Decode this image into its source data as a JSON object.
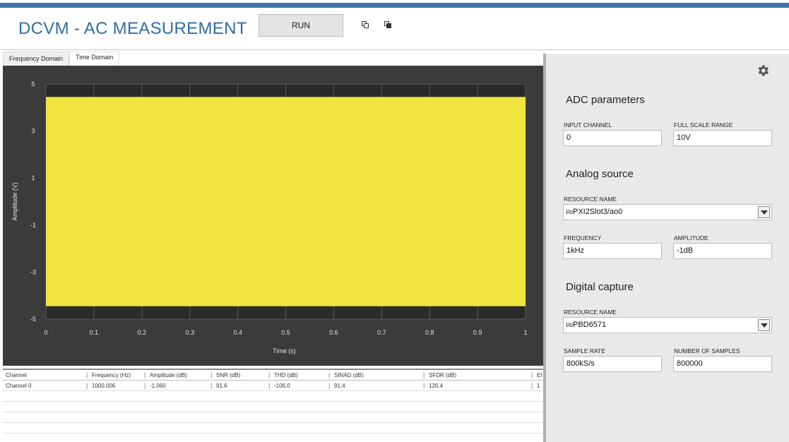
{
  "app": {
    "title": "DCVM  -  AC MEASUREMENT",
    "run_label": "RUN",
    "accent_color": "#3c74a8"
  },
  "icons": [
    "restore-window-icon",
    "restore-window-filled-icon",
    "gear-icon",
    "io-channel-icon",
    "dropdown-arrow-icon"
  ],
  "tabs": [
    {
      "label": "Frequency Domain",
      "active": false
    },
    {
      "label": "Time Domain",
      "active": true
    }
  ],
  "chart_data": {
    "type": "area",
    "title": "",
    "xlabel": "Time (s)",
    "ylabel": "Amplitude (V)",
    "xlim": [
      0,
      1
    ],
    "ylim": [
      -5,
      5
    ],
    "x_ticks": [
      "0",
      "0.1",
      "0.2",
      "0.3",
      "0.4",
      "0.5",
      "0.6",
      "0.7",
      "0.8",
      "0.9",
      "1"
    ],
    "y_ticks": [
      "5",
      "3",
      "1",
      "-1",
      "-3",
      "-5"
    ],
    "grid": true,
    "series": [
      {
        "color": "#f0e43e",
        "upper": 4.45,
        "lower": -4.45
      }
    ],
    "plot_background": "#2a2a2a"
  },
  "results_table": {
    "columns": [
      "Channel",
      "Frequency (Hz)",
      "Amplitude (dB)",
      "SNR (dB)",
      "THD (dB)",
      "SINAD (dB)",
      "SFDR (dB)",
      "El"
    ],
    "rows": [
      [
        "Channel 0",
        "1000.006",
        "-1.060",
        "91.6",
        "-106.0",
        "91.4",
        "120.4",
        "1"
      ]
    ]
  },
  "settings": {
    "adc": {
      "title": "ADC parameters",
      "input_channel_label": "INPUT CHANNEL",
      "input_channel_value": "0",
      "full_scale_label": "FULL SCALE RANGE",
      "full_scale_value": "10V"
    },
    "analog": {
      "title": "Analog source",
      "resource_label": "RESOURCE NAME",
      "resource_value": "PXI2Slot3/ao0",
      "frequency_label": "FREQUENCY",
      "frequency_value": "1kHz",
      "amplitude_label": "AMPLITUDE",
      "amplitude_value": "-1dB"
    },
    "digital": {
      "title": "Digital capture",
      "resource_label": "RESOURCE NAME",
      "resource_value": "PBD6571",
      "sample_rate_label": "SAMPLE RATE",
      "sample_rate_value": "800kS/s",
      "num_samples_label": "NUMBER OF SAMPLES",
      "num_samples_value": "800000"
    }
  }
}
